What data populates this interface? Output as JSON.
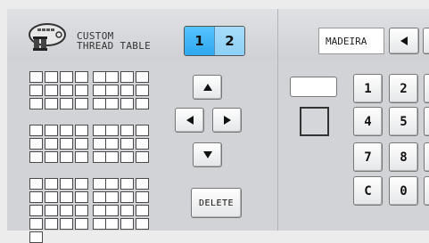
{
  "header": {
    "title_line1": "CUSTOM",
    "title_line2": "THREAD TABLE",
    "logo_icon": "spool-table-icon",
    "tabs": [
      {
        "label": "1",
        "active": true
      },
      {
        "label": "2",
        "active": false
      }
    ],
    "brand": {
      "value": "MADEIRA",
      "prev_icon": "triangle-left-icon"
    }
  },
  "grid": {
    "rows": 10,
    "columns": 8,
    "extra_cells": 1,
    "cell_color": "#ffffff"
  },
  "arrows": {
    "up_icon": "triangle-up-icon",
    "down_icon": "triangle-down-icon",
    "left_icon": "triangle-left-icon",
    "right_icon": "triangle-right-icon"
  },
  "delete_label": "DELETE",
  "keypad": {
    "keys": [
      "1",
      "2",
      "4",
      "5",
      "7",
      "8",
      "C",
      "0"
    ]
  },
  "colors": {
    "tab_active": "#2ea8ef",
    "tab_inactive": "#8dcff5",
    "panel": "#d1d3d6"
  }
}
